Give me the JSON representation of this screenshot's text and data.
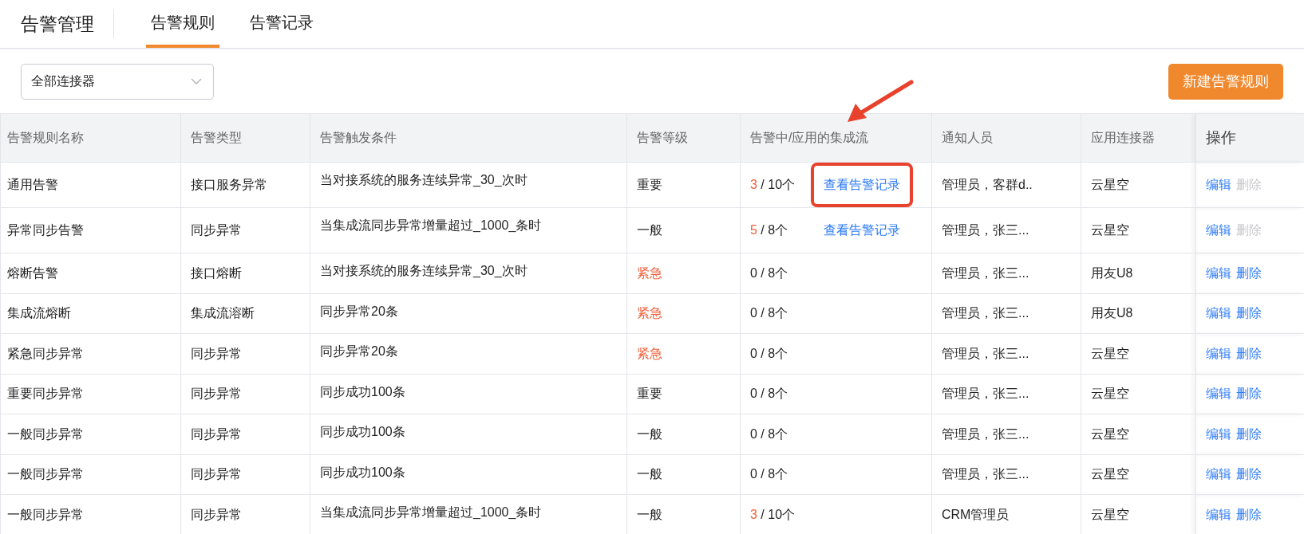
{
  "header": {
    "title": "告警管理",
    "tabs": [
      {
        "label": "告警规则",
        "selected": true
      },
      {
        "label": "告警记录",
        "selected": false
      }
    ]
  },
  "filter": {
    "value": "全部连接器"
  },
  "new_button": "新建告警规则",
  "table": {
    "columns": [
      "告警规则名称",
      "告警类型",
      "告警触发条件",
      "告警等级",
      "告警中/应用的集成流",
      "通知人员",
      "应用连接器",
      "操作"
    ],
    "rows": [
      {
        "name": "通用告警",
        "type": "接口服务异常",
        "condition": "当对接系统的服务连续异常_30_次时",
        "level": {
          "text": "重要",
          "urgent": false
        },
        "alerting": {
          "count": "3",
          "active": true,
          "total": "/ 10个"
        },
        "link": {
          "label": "查看告警记录",
          "highlighted": true
        },
        "notify": "管理员，客群d..",
        "connector": "云星空",
        "edit": "编辑",
        "delete": {
          "label": "删除",
          "disabled": true
        }
      },
      {
        "name": "异常同步告警",
        "type": "同步异常",
        "condition": "当集成流同步异常增量超过_1000_条时",
        "level": {
          "text": "一般",
          "urgent": false
        },
        "alerting": {
          "count": "5",
          "active": true,
          "total": "/ 8个"
        },
        "link": {
          "label": "查看告警记录",
          "highlighted": false
        },
        "notify": "管理员，张三...",
        "connector": "云星空",
        "edit": "编辑",
        "delete": {
          "label": "删除",
          "disabled": true
        }
      },
      {
        "name": "熔断告警",
        "type": "接口熔断",
        "condition": "当对接系统的服务连续异常_30_次时",
        "level": {
          "text": "紧急",
          "urgent": true
        },
        "alerting": {
          "count": "0",
          "active": false,
          "total": "/ 8个"
        },
        "notify": "管理员，张三...",
        "connector": "用友U8",
        "edit": "编辑",
        "delete": {
          "label": "删除",
          "disabled": false
        }
      },
      {
        "name": "集成流熔断",
        "type": "集成流溶断",
        "condition": "同步异常20条",
        "level": {
          "text": "紧急",
          "urgent": true
        },
        "alerting": {
          "count": "0",
          "active": false,
          "total": "/ 8个"
        },
        "notify": "管理员，张三...",
        "connector": "用友U8",
        "edit": "编辑",
        "delete": {
          "label": "删除",
          "disabled": false
        }
      },
      {
        "name": "紧急同步异常",
        "type": "同步异常",
        "condition": "同步异常20条",
        "level": {
          "text": "紧急",
          "urgent": true
        },
        "alerting": {
          "count": "0",
          "active": false,
          "total": "/ 8个"
        },
        "notify": "管理员，张三...",
        "connector": "云星空",
        "edit": "编辑",
        "delete": {
          "label": "删除",
          "disabled": false
        }
      },
      {
        "name": "重要同步异常",
        "type": "同步异常",
        "condition": "同步成功100条",
        "level": {
          "text": "重要",
          "urgent": false
        },
        "alerting": {
          "count": "0",
          "active": false,
          "total": "/ 8个"
        },
        "notify": "管理员，张三...",
        "connector": "云星空",
        "edit": "编辑",
        "delete": {
          "label": "删除",
          "disabled": false
        }
      },
      {
        "name": "一般同步异常",
        "type": "同步异常",
        "condition": "同步成功100条",
        "level": {
          "text": "一般",
          "urgent": false
        },
        "alerting": {
          "count": "0",
          "active": false,
          "total": "/ 8个"
        },
        "notify": "管理员，张三...",
        "connector": "云星空",
        "edit": "编辑",
        "delete": {
          "label": "删除",
          "disabled": false
        }
      },
      {
        "name": "一般同步异常",
        "type": "同步异常",
        "condition": "同步成功100条",
        "level": {
          "text": "一般",
          "urgent": false
        },
        "alerting": {
          "count": "0",
          "active": false,
          "total": "/ 8个"
        },
        "notify": "管理员，张三...",
        "connector": "云星空",
        "edit": "编辑",
        "delete": {
          "label": "删除",
          "disabled": false
        }
      },
      {
        "name": "一般同步异常",
        "type": "同步异常",
        "condition": "当集成流同步异常增量超过_1000_条时",
        "level": {
          "text": "一般",
          "urgent": false
        },
        "alerting": {
          "count": "3",
          "active": true,
          "total": "/ 10个"
        },
        "notify": "CRM管理员",
        "connector": "云星空",
        "edit": "编辑",
        "delete": {
          "label": "删除",
          "disabled": false
        }
      }
    ]
  }
}
